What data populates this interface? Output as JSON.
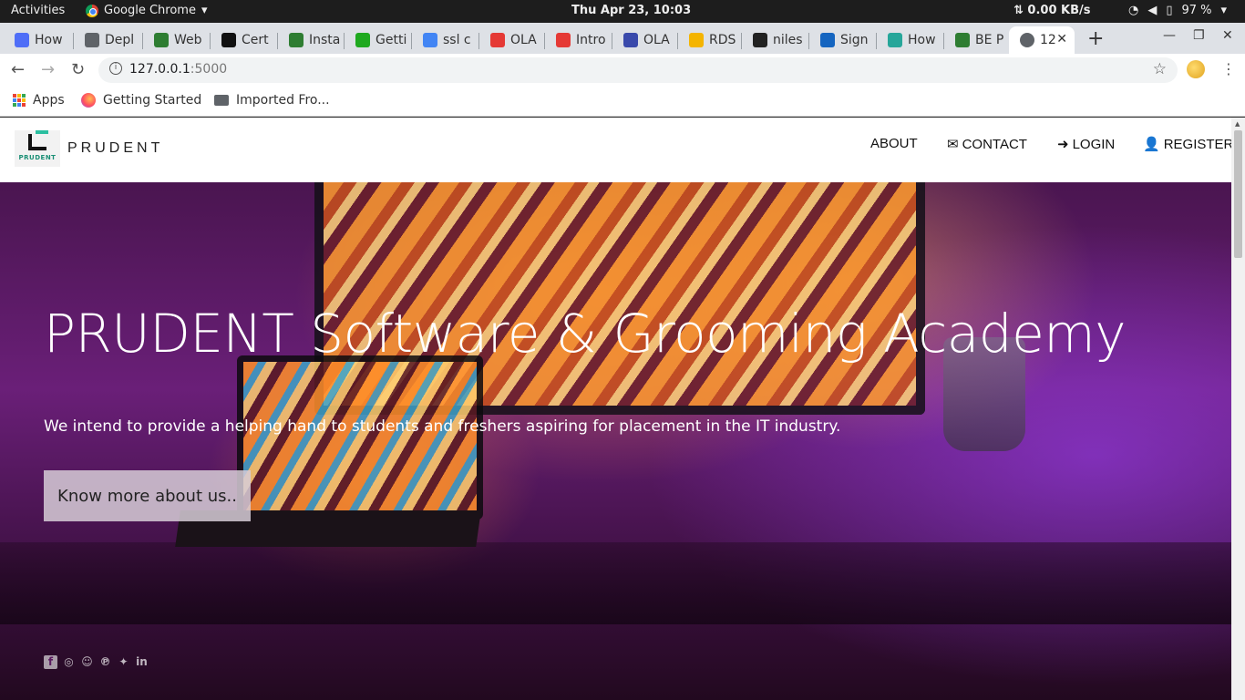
{
  "os": {
    "activities": "Activities",
    "app_name": "Google Chrome",
    "clock": "Thu Apr 23, 10:03",
    "network": "⇅ 0.00 KB/s",
    "battery": "97 %"
  },
  "tabs": [
    {
      "label": "How",
      "color": "#4f6ef7"
    },
    {
      "label": "Depl",
      "color": "#5f6368"
    },
    {
      "label": "Web",
      "color": "#2e7d32"
    },
    {
      "label": "Cert",
      "color": "#111111"
    },
    {
      "label": "Insta",
      "color": "#2e7d32"
    },
    {
      "label": "Getti",
      "color": "#1fa91f"
    },
    {
      "label": "ssl c",
      "color": "#4285f4"
    },
    {
      "label": "OLA",
      "color": "#e53935"
    },
    {
      "label": "Intro",
      "color": "#e53935"
    },
    {
      "label": "OLA",
      "color": "#3949ab"
    },
    {
      "label": "RDS",
      "color": "#f4b400"
    },
    {
      "label": "niles",
      "color": "#222222"
    },
    {
      "label": "Sign",
      "color": "#1565c0"
    },
    {
      "label": "How",
      "color": "#26a69a"
    },
    {
      "label": "BE P",
      "color": "#2e7d32"
    },
    {
      "label": "12",
      "color": "#5f6368"
    }
  ],
  "address_bar": {
    "host": "127.0.0.1",
    "port": ":5000"
  },
  "bookmarks": {
    "apps": "Apps",
    "getting_started": "Getting Started",
    "imported": "Imported Fro..."
  },
  "site": {
    "brand": "PRUDENT",
    "logo_text": "PRUDENT",
    "menu": {
      "about": "ABOUT",
      "contact": "CONTACT",
      "login": "LOGIN",
      "register": "REGISTER"
    },
    "hero": {
      "title": "PRUDENT Software & Grooming Academy",
      "subtitle": "We intend to provide a helping hand to students and freshers aspiring for placement in the IT industry.",
      "cta": "Know more about us.."
    },
    "social_icons": [
      "facebook-icon",
      "instagram-icon",
      "snapchat-icon",
      "pinterest-icon",
      "twitter-icon",
      "linkedin-icon"
    ]
  }
}
